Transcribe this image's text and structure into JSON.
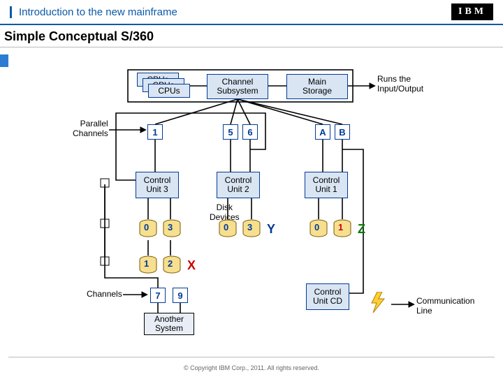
{
  "header": {
    "subtitle": "Introduction to the new mainframe",
    "logo": "IBM"
  },
  "title": "Simple Conceptual S/360",
  "labels": {
    "runs_io": "Runs the\nInput/Output",
    "parallel_channels": "Parallel\nChannels",
    "channels": "Channels",
    "disk_devices": "Disk\nDevices",
    "another_system": "Another\nSystem",
    "communication_line": "Communication\nLine"
  },
  "blocks": {
    "cpu_a": "CPUs",
    "cpu_b": "CPUs",
    "cpu_c": "CPUs",
    "channel_subsys": "Channel\nSubsystem",
    "main_storage": "Main\nStorage",
    "cu1": "Control\nUnit 1",
    "cu2": "Control\nUnit 2",
    "cu3": "Control\nUnit 3",
    "cu_cd": "Control\nUnit CD"
  },
  "channel_ids": {
    "c1": "1",
    "c5": "5",
    "c6": "6",
    "cA": "A",
    "cB": "B",
    "c7": "7",
    "c9": "9"
  },
  "disks": {
    "cu3": [
      {
        "id": "0"
      },
      {
        "id": "3"
      },
      {
        "id": "1"
      },
      {
        "id": "2"
      }
    ],
    "cu2": [
      {
        "id": "0"
      },
      {
        "id": "3"
      }
    ],
    "cu1": [
      {
        "id": "0"
      },
      {
        "id": "1"
      }
    ]
  },
  "bus_letters": {
    "x": "X",
    "y": "Y",
    "z": "Z"
  },
  "footer": "© Copyright IBM Corp., 2011. All rights reserved."
}
